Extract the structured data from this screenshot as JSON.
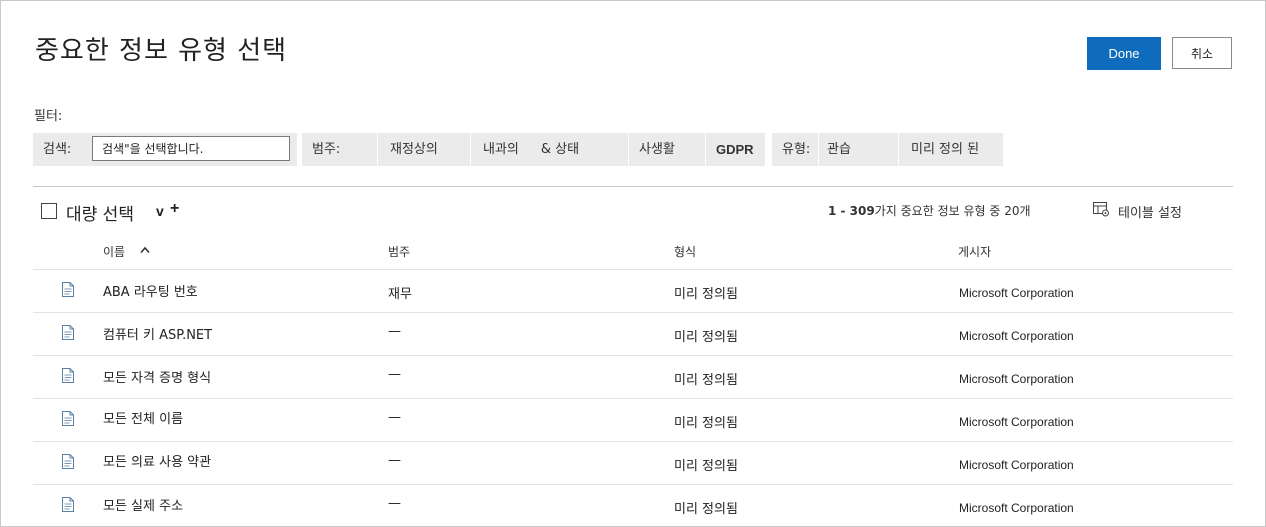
{
  "dialog": {
    "title": "중요한 정보 유형 선택",
    "done_label": "Done",
    "cancel_label": "취소"
  },
  "filters": {
    "label": "필터:",
    "search_label": "검색:",
    "search_value": "검색\"을 선택합니다.",
    "category_label": "범주:",
    "categories": [
      "재정상의",
      "내과의",
      "& 상태",
      "사생활",
      "GDPR"
    ],
    "type_label": "유형:",
    "types": [
      "관습",
      "미리 정의 된"
    ]
  },
  "toolbar": {
    "bulk_select_label": "대량 선택",
    "bulk_v": "v",
    "bulk_plus": "+",
    "count_bold": "1 - 309",
    "count_rest": "가지 중요한 정보 유형 중 20개",
    "table_settings_label": "테이블 설정"
  },
  "table": {
    "columns": [
      "이름",
      "범주",
      "형식",
      "게시자"
    ],
    "sorted_column": "이름",
    "rows": [
      {
        "name": "ABA 라우팅 번호",
        "category": "재무",
        "format": "미리 정의됨",
        "publisher": "Microsoft Corporation"
      },
      {
        "name": "컴퓨터 키 ASP.NET",
        "category": "—",
        "format": "미리 정의됨",
        "publisher": "Microsoft Corporation"
      },
      {
        "name": "모든 자격 증명 형식",
        "category": "—",
        "format": "미리 정의됨",
        "publisher": "Microsoft Corporation"
      },
      {
        "name": "모든 전체 이름",
        "category": "—",
        "format": "미리 정의됨",
        "publisher": "Microsoft Corporation"
      },
      {
        "name": "모든 의료 사용 약관",
        "category": "—",
        "format": "미리 정의됨",
        "publisher": "Microsoft Corporation"
      },
      {
        "name": "모든 실제 주소",
        "category": "—",
        "format": "미리 정의됨",
        "publisher": "Microsoft Corporation"
      }
    ]
  },
  "colors": {
    "accent": "#0f6cbd",
    "filter_bg": "#ebebeb",
    "border": "#c8c8c8"
  },
  "icons": [
    "sort-ascending-icon",
    "document-icon",
    "table-settings-icon",
    "checkbox-icon"
  ]
}
